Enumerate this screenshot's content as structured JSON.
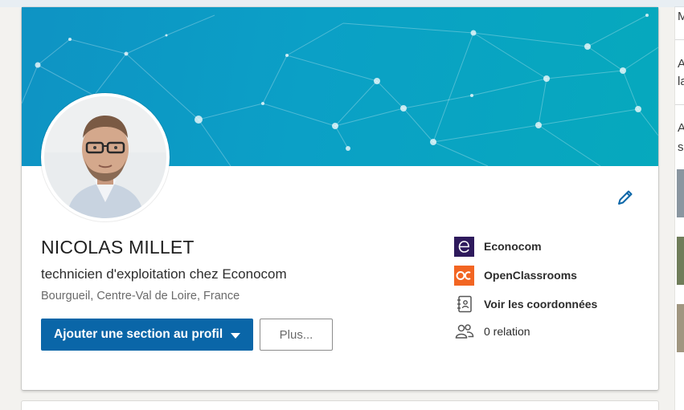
{
  "profile": {
    "name": "NICOLAS MILLET",
    "headline": "technicien d'exploitation chez Econocom",
    "location": "Bourgueil, Centre-Val de Loire, France"
  },
  "actions": {
    "add_section_label": "Ajouter une section au profil",
    "more_label": "Plus..."
  },
  "side_info": [
    {
      "label": "Econocom",
      "icon": "econocom-logo"
    },
    {
      "label": "OpenClassrooms",
      "icon": "openclassrooms-logo"
    },
    {
      "label": "Voir les coordonnées",
      "icon": "contact-card-icon"
    },
    {
      "label": "0 relation",
      "icon": "people-icon"
    }
  ],
  "right_column": {
    "line1": "M",
    "line2": "A",
    "line3": "la",
    "line4": "A",
    "line5": "s"
  },
  "colors": {
    "primary": "#0a66a8",
    "banner_start": "#0e93c4",
    "banner_end": "#06a9bd",
    "econocom": "#2e1a5c",
    "openclassrooms": "#f26522"
  },
  "icons": {
    "edit": "pencil-icon",
    "dropdown": "caret-down-icon"
  }
}
